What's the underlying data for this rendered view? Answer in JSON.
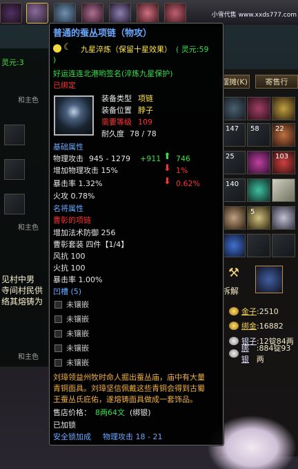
{
  "watermark": "小雪代售 www.xxds777.com",
  "background": {
    "left_texts": [
      "灵元:3",
      "和主色",
      "和主色",
      "见村中男",
      "寺间村民供",
      "络其熔铸为",
      "和主色"
    ],
    "right_tabs": [
      "摆摊(K)",
      "寄售行"
    ],
    "slot_counts": [
      "147",
      "58",
      "22",
      "25",
      "103",
      "140",
      "5"
    ],
    "split_label": "拆解",
    "money": [
      {
        "label": "金子",
        "value": ":2510"
      },
      {
        "label": "绑金",
        "value": ":16882"
      },
      {
        "label": "银子",
        "value": ":12锭84两"
      },
      {
        "label": "绑银",
        "value": ":884锭93两"
      }
    ]
  },
  "tooltip": {
    "title": "普通的蚕丛项链（物攻）",
    "refine": "九星淬炼（保留十星效果）",
    "spirit": "( 灵元:59",
    "spirit_close": ")",
    "title_line": "好运连连北港哟签名(淬炼九星保护)",
    "bound": "已绑定",
    "type_label": "装备类型",
    "type_value": "项链",
    "pos_label": "装备位置",
    "pos_value": "脖子",
    "req_label": "需要等级",
    "req_value": "109",
    "dur_label": "耐久度",
    "dur_value": "78 / 78",
    "basic_header": "基础属性",
    "phys_label": "物理攻击",
    "phys_value": "945 - 1279",
    "phys_bonus": "+911",
    "phys_compare": "746",
    "add_phys": "增加物理攻击 15%",
    "add_phys_compare": "1%",
    "crit": "暴击率  1.32%",
    "crit_compare": "0.62%",
    "fire_atk": "火攻  0.78%",
    "named_header": "名将属性",
    "hero_name": "曹彰的项链",
    "magic_def": "增加法术防御 256",
    "set_line": "曹彰套装  四件【1/4】",
    "wind_res": "风抗 100",
    "fire_res": "火抗 100",
    "crit2": "暴击率 1.00%",
    "slot_header": "凹槽 (5)",
    "empty_slot": "未镶嵌",
    "slot_count": 5,
    "lore1": "刘璋领益州牧时命人掘出蚕丛庙，庙中有大量",
    "lore2": "青铜面具。刘璋坚信佩戴这些青铜会得到古蜀",
    "lore3": "王蚕丛氏庇佑，遂熔铸面具做成一套饰品。",
    "price_label": "售店价格：",
    "price_value": "8两64文",
    "price_note": "(绑银)",
    "locked": "已加锁",
    "safe_lock": "安全锁加成",
    "safe_bonus": "物理攻击 18 - 21"
  }
}
